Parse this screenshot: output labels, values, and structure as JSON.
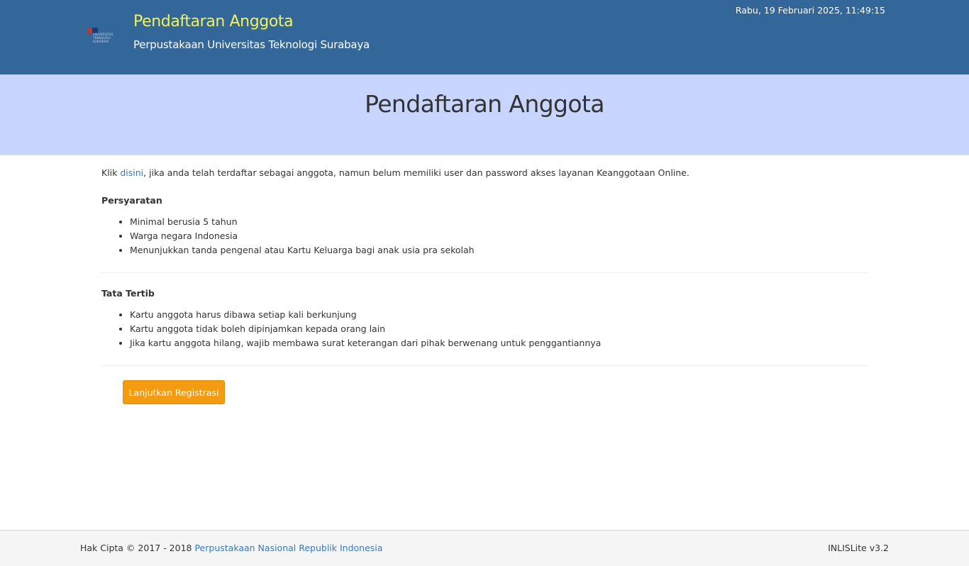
{
  "header": {
    "logo_text": "UNIVERSITAS\nTEKNOLOGI\nSURABAYA",
    "title": "Pendaftaran Anggota",
    "subtitle": "Perpustakaan Universitas Teknologi Surabaya",
    "datetime": "Rabu, 19 Februari 2025, 11:49:15"
  },
  "banner": {
    "title": "Pendaftaran Anggota"
  },
  "intro": {
    "prefix": "Klik ",
    "link_text": "disini",
    "suffix": ", jika anda telah terdaftar sebagai anggota, namun belum memiliki user dan password akses layanan Keanggotaan Online."
  },
  "requirements": {
    "title": "Persyaratan",
    "items": [
      "Minimal berusia 5 tahun",
      "Warga negara Indonesia",
      "Menunjukkan tanda pengenal atau Kartu Keluarga bagi anak usia pra sekolah"
    ]
  },
  "rules": {
    "title": "Tata Tertib",
    "items": [
      "Kartu anggota harus dibawa setiap kali berkunjung",
      "Kartu anggota tidak boleh dipinjamkan kepada orang lain",
      "Jika kartu anggota hilang, wajib membawa surat keterangan dari pihak berwenang untuk penggantiannya"
    ]
  },
  "actions": {
    "continue_label": "Lanjutkan Registrasi"
  },
  "footer": {
    "copyright_prefix": "Hak Cipta © 2017 - 2018 ",
    "copyright_link": "Perpustakaan Nasional Republik Indonesia",
    "version": "INLISLite v3.2"
  },
  "colors": {
    "header_bg": "#336699",
    "title_yellow": "#f2f25c",
    "banner_bg": "#c7d5ff",
    "link": "#3a7ab7",
    "button_bg": "#f39c12",
    "footer_bg": "#f5f5f5"
  }
}
